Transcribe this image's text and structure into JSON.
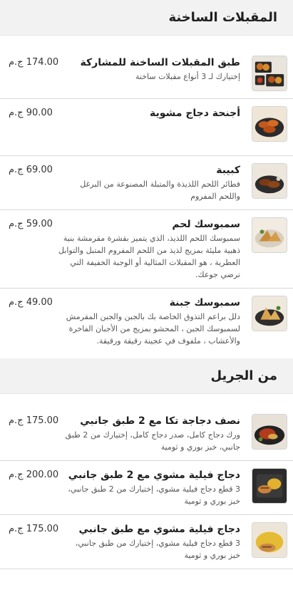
{
  "sections": [
    {
      "title": "المقبلات الساخنة",
      "items": [
        {
          "name": "طبق المقبلات الساخنة للمشاركة",
          "desc": "إختيارك لـ 3 أنواع مقبلات ساخنة",
          "price": "174.00 ج.م",
          "image": "hot-appetizer-platter"
        },
        {
          "name": "أجنحة دجاج مشوية",
          "desc": "",
          "price": "90.00 ج.م",
          "image": "grilled-wings"
        },
        {
          "name": "كبيبة",
          "desc": "فطائر اللحم اللذيذة والمتبلة المصنوعة من البرغل واللحم المفروم",
          "price": "69.00 ج.م",
          "image": "kibbeh"
        },
        {
          "name": "سمبوسك لحم",
          "desc": "سمبوسك اللحم اللذيذ، الذي يتميز بقشرة مقرمشة بنية ذهبية مليئة بمزيج لذيذ من اللحم المفروم المتبل والتوابل العطرية ، هو المقبلات المثالية أو الوجبة الخفيفة التي ترضي جوعك.",
          "price": "59.00 ج.م",
          "image": "meat-sambousek"
        },
        {
          "name": "سمبوسك جبنة",
          "desc": "دلل براعم التذوق الخاصة بك بالجبن والجبن المقرمش لسمبوسك الجبن ، المحشو بمزيج من الأجبان الفاخرة والأعشاب ، ملفوف في عجينة رقيقة ورقيقة.",
          "price": "49.00 ج.م",
          "image": "cheese-sambousek"
        }
      ]
    },
    {
      "title": "من الجريل",
      "items": [
        {
          "name": "نصف دجاجة تكا مع 2 طبق جانبي",
          "desc": "ورك دجاج كامل، صدر دجاج كامل، إختيارك من 2 طبق جانبي، خبز بوري و ثومية",
          "price": "175.00 ج.م",
          "image": "half-chicken-tikka"
        },
        {
          "name": "دجاج فيلية مشوي مع 2 طبق جانبي",
          "desc": "3 قطع دجاج فيلية مشوي، إختيارك من 2 طبق جانبي، خبز بوري و ثومية",
          "price": "200.00 ج.م",
          "image": "grilled-fillet-two-sides"
        },
        {
          "name": "دجاج فيلية مشوي مع طبق جانبي",
          "desc": "3 قطع دجاج فيلية مشوي، إختيارك من طبق جانبي، خبز بوري و ثومية",
          "price": "175.00 ج.م",
          "image": "grilled-fillet-one-side"
        }
      ]
    }
  ]
}
